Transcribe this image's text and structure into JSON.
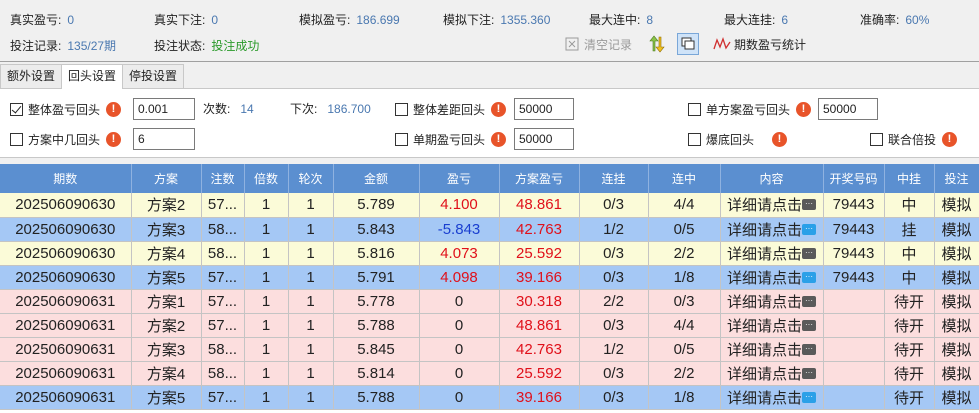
{
  "stats": [
    {
      "label": "真实盈亏:",
      "value": "0",
      "color": "blue"
    },
    {
      "label": "真实下注:",
      "value": "0",
      "color": "blue"
    },
    {
      "label": "模拟盈亏:",
      "value": "186.699",
      "color": "blue"
    },
    {
      "label": "模拟下注:",
      "value": "1355.360",
      "color": "blue"
    },
    {
      "label": "最大连中:",
      "value": "8",
      "color": "blue"
    },
    {
      "label": "最大连挂:",
      "value": "6",
      "color": "blue"
    },
    {
      "label": "准确率:",
      "value": "60%",
      "color": "blue"
    },
    {
      "label": "投注记录:",
      "value": "135/27期",
      "color": "blue"
    },
    {
      "label": "投注状态:",
      "value": "投注成功",
      "color": "green"
    }
  ],
  "toolbar": {
    "clear_label": "清空记录",
    "stats_label": "期数盈亏统计"
  },
  "tabs": [
    "额外设置",
    "回头设置",
    "停投设置"
  ],
  "active_tab": 1,
  "panel": {
    "overall_label": "整体盈亏回头",
    "overall_value": "0.001",
    "count_label": "次数:",
    "count_value": "14",
    "next_label": "下次:",
    "next_value": "186.700",
    "diff_label": "整体差距回头",
    "diff_value": "50000",
    "single_plan_label": "单方案盈亏回头",
    "single_plan_value": "50000",
    "plan_hit_label": "方案中几回头",
    "plan_hit_value": "6",
    "single_issue_label": "单期盈亏回头",
    "single_issue_value": "50000",
    "bottom_label": "爆底回头",
    "joint_label": "联合倍投"
  },
  "table": {
    "headers": [
      "期数",
      "方案",
      "注数",
      "倍数",
      "轮次",
      "金额",
      "盈亏",
      "方案盈亏",
      "连挂",
      "连中",
      "内容",
      "开奖号码",
      "中挂",
      "投注"
    ],
    "rows": [
      {
        "style": "yellow",
        "cells": [
          "202506090630",
          "方案2",
          "57...",
          "1",
          "1",
          "5.789",
          "4.100",
          "48.861",
          "0/3",
          "4/4",
          "详细请点击",
          "79443",
          "中",
          "模拟"
        ],
        "pl": "red"
      },
      {
        "style": "blue",
        "cells": [
          "202506090630",
          "方案3",
          "58...",
          "1",
          "1",
          "5.843",
          "-5.843",
          "42.763",
          "1/2",
          "0/5",
          "详细请点击",
          "79443",
          "挂",
          "模拟"
        ],
        "pl": "neg"
      },
      {
        "style": "yellow",
        "cells": [
          "202506090630",
          "方案4",
          "58...",
          "1",
          "1",
          "5.816",
          "4.073",
          "25.592",
          "0/3",
          "2/2",
          "详细请点击",
          "79443",
          "中",
          "模拟"
        ],
        "pl": "red"
      },
      {
        "style": "blue",
        "cells": [
          "202506090630",
          "方案5",
          "57...",
          "1",
          "1",
          "5.791",
          "4.098",
          "39.166",
          "0/3",
          "1/8",
          "详细请点击",
          "79443",
          "中",
          "模拟"
        ],
        "pl": "red"
      },
      {
        "style": "pink",
        "cells": [
          "202506090631",
          "方案1",
          "57...",
          "1",
          "1",
          "5.778",
          "0",
          "30.318",
          "2/2",
          "0/3",
          "详细请点击",
          "",
          "待开",
          "模拟"
        ],
        "pl": "none"
      },
      {
        "style": "pink",
        "cells": [
          "202506090631",
          "方案2",
          "57...",
          "1",
          "1",
          "5.788",
          "0",
          "48.861",
          "0/3",
          "4/4",
          "详细请点击",
          "",
          "待开",
          "模拟"
        ],
        "pl": "none"
      },
      {
        "style": "pink",
        "cells": [
          "202506090631",
          "方案3",
          "58...",
          "1",
          "1",
          "5.845",
          "0",
          "42.763",
          "1/2",
          "0/5",
          "详细请点击",
          "",
          "待开",
          "模拟"
        ],
        "pl": "none"
      },
      {
        "style": "pink",
        "cells": [
          "202506090631",
          "方案4",
          "58...",
          "1",
          "1",
          "5.814",
          "0",
          "25.592",
          "0/3",
          "2/2",
          "详细请点击",
          "",
          "待开",
          "模拟"
        ],
        "pl": "none"
      },
      {
        "style": "blue",
        "cells": [
          "202506090631",
          "方案5",
          "57...",
          "1",
          "1",
          "5.788",
          "0",
          "39.166",
          "0/3",
          "1/8",
          "详细请点击",
          "",
          "待开",
          "模拟"
        ],
        "pl": "none"
      }
    ]
  }
}
